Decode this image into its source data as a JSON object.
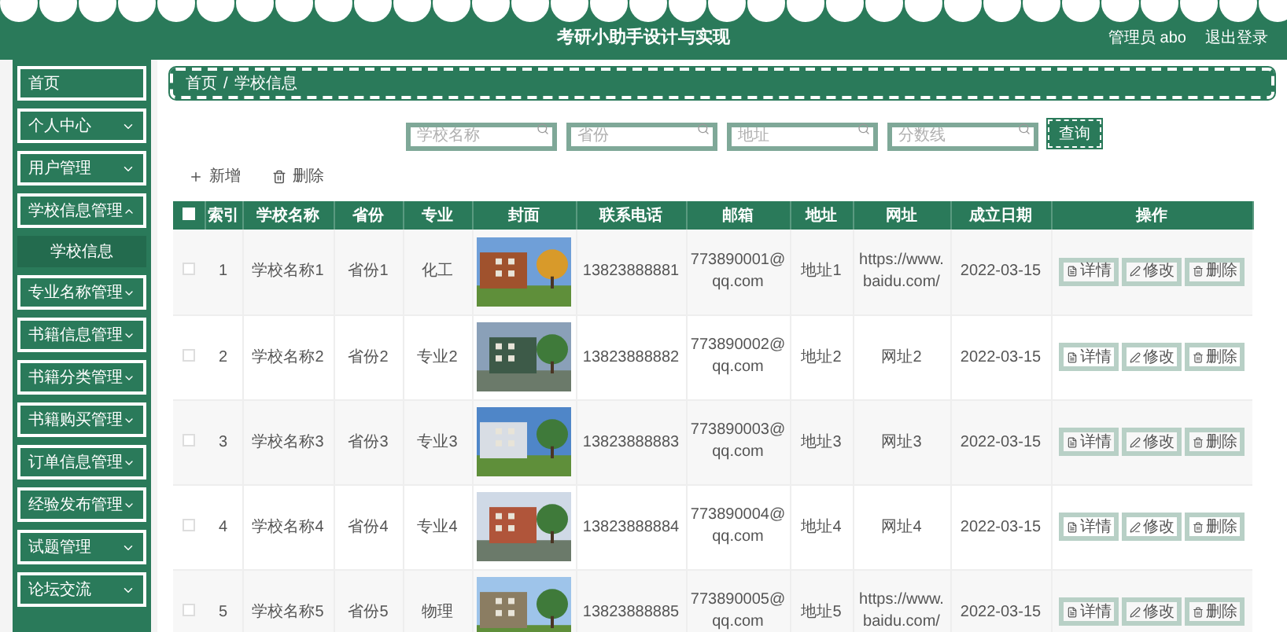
{
  "header": {
    "title": "考研小助手设计与实现",
    "user": "管理员 abo",
    "logout": "退出登录"
  },
  "sidebar": {
    "items": [
      {
        "label": "首页",
        "kind": "link"
      },
      {
        "label": "个人中心",
        "kind": "menu",
        "expanded": false
      },
      {
        "label": "用户管理",
        "kind": "menu",
        "expanded": false
      },
      {
        "label": "学校信息管理",
        "kind": "menu",
        "expanded": true,
        "children": [
          {
            "label": "学校信息",
            "selected": true
          }
        ]
      },
      {
        "label": "专业名称管理",
        "kind": "menu",
        "expanded": false
      },
      {
        "label": "书籍信息管理",
        "kind": "menu",
        "expanded": false
      },
      {
        "label": "书籍分类管理",
        "kind": "menu",
        "expanded": false
      },
      {
        "label": "书籍购买管理",
        "kind": "menu",
        "expanded": false
      },
      {
        "label": "订单信息管理",
        "kind": "menu",
        "expanded": false
      },
      {
        "label": "经验发布管理",
        "kind": "menu",
        "expanded": false
      },
      {
        "label": "试题管理",
        "kind": "menu",
        "expanded": false
      },
      {
        "label": "论坛交流",
        "kind": "menu",
        "expanded": false
      }
    ]
  },
  "breadcrumb": {
    "items": [
      "首页",
      "学校信息"
    ],
    "separator": "/"
  },
  "search": {
    "fields": [
      {
        "placeholder": "学校名称"
      },
      {
        "placeholder": "省份"
      },
      {
        "placeholder": "地址"
      },
      {
        "placeholder": "分数线"
      }
    ],
    "button": "查询"
  },
  "toolbar": {
    "add": "新增",
    "delete": "删除"
  },
  "table": {
    "select_all_checked": false,
    "columns": [
      "索引",
      "学校名称",
      "省份",
      "专业",
      "封面",
      "联系电话",
      "邮箱",
      "地址",
      "网址",
      "成立日期",
      "操作"
    ],
    "rows": [
      {
        "checked": false,
        "cells": [
          "1",
          "学校名称1",
          "省份1",
          "化工",
          null,
          "13823888881",
          "773890001@qq.com",
          "地址1",
          "https://www.baidu.com/",
          "2022-03-15"
        ],
        "actions": [
          "详情",
          "修改",
          "删除"
        ]
      },
      {
        "checked": false,
        "cells": [
          "2",
          "学校名称2",
          "省份2",
          "专业2",
          null,
          "13823888882",
          "773890002@qq.com",
          "地址2",
          "网址2",
          "2022-03-15"
        ],
        "actions": [
          "详情",
          "修改",
          "删除"
        ]
      },
      {
        "checked": false,
        "cells": [
          "3",
          "学校名称3",
          "省份3",
          "专业3",
          null,
          "13823888883",
          "773890003@qq.com",
          "地址3",
          "网址3",
          "2022-03-15"
        ],
        "actions": [
          "详情",
          "修改",
          "删除"
        ]
      },
      {
        "checked": false,
        "cells": [
          "4",
          "学校名称4",
          "省份4",
          "专业4",
          null,
          "13823888884",
          "773890004@qq.com",
          "地址4",
          "网址4",
          "2022-03-15"
        ],
        "actions": [
          "详情",
          "修改",
          "删除"
        ]
      },
      {
        "checked": false,
        "cells": [
          "5",
          "学校名称5",
          "省份5",
          "物理",
          null,
          "13823888885",
          "773890005@qq.com",
          "地址5",
          "https://www.baidu.com/",
          "2022-03-15"
        ],
        "actions": [
          "详情",
          "修改",
          "删除"
        ]
      }
    ]
  }
}
